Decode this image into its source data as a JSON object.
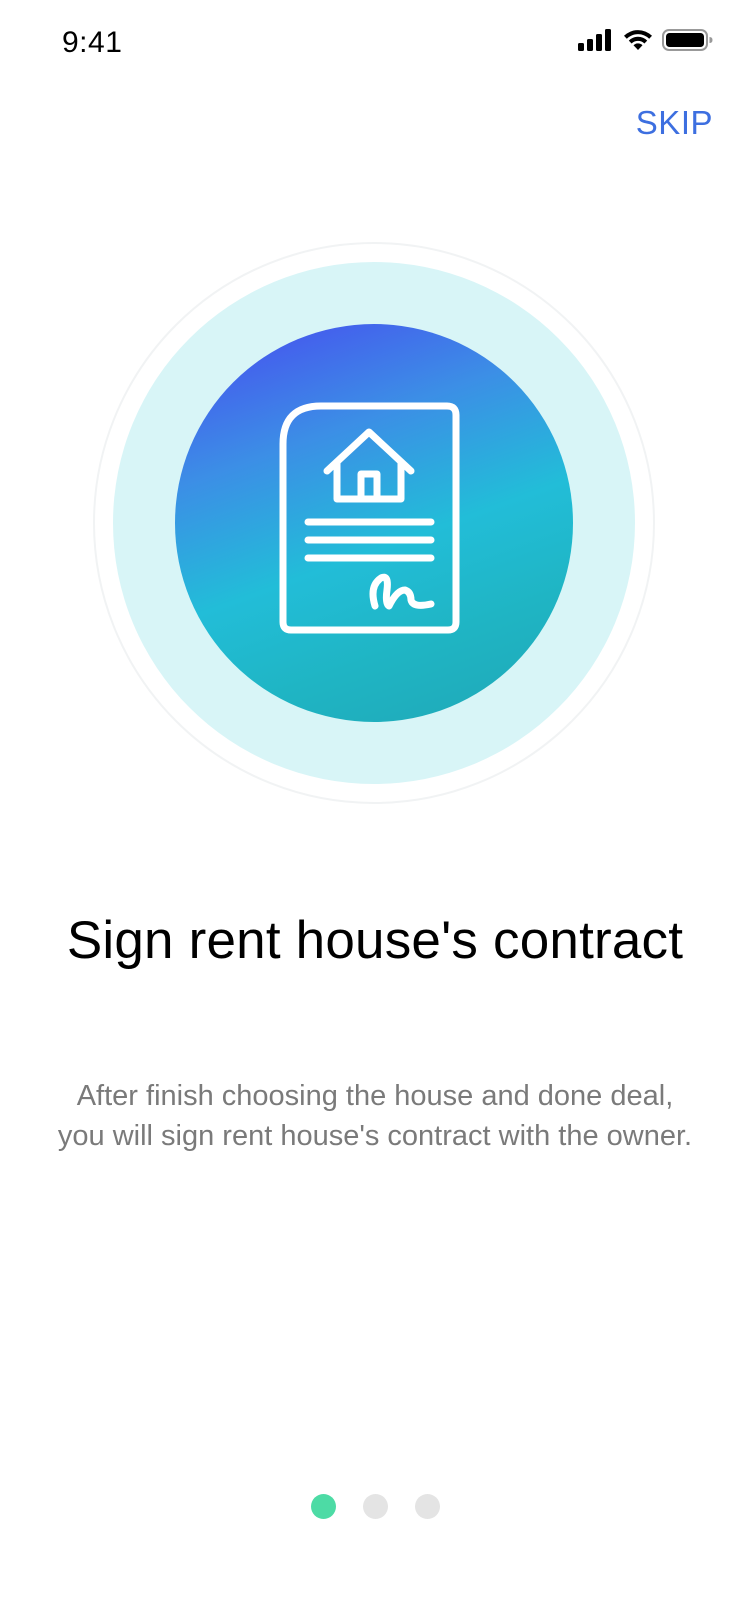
{
  "status_bar": {
    "time": "9:41",
    "icons": [
      "cellular-signal-icon",
      "wifi-icon",
      "battery-icon"
    ]
  },
  "header": {
    "skip_label": "SKIP"
  },
  "hero": {
    "icon": "house-contract-icon",
    "colors": {
      "halo": "#d8f5f7",
      "gradient_start": "#4848f0",
      "gradient_end": "#1fa7b6"
    }
  },
  "content": {
    "title": "Sign rent house's contract",
    "description": "After finish choosing the house and done deal, you will sign rent house's contract with the owner."
  },
  "pager": {
    "total": 3,
    "active_index": 0,
    "active_color": "#4ddba5",
    "inactive_color": "#e4e4e4"
  },
  "theme": {
    "accent": "#3d6fe0",
    "text_secondary": "#7a7a7a"
  }
}
